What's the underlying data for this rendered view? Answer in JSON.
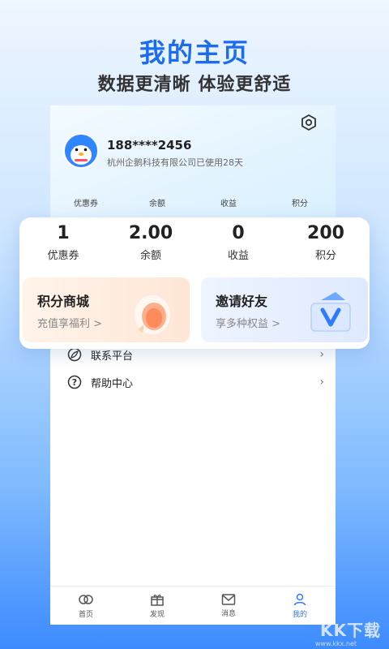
{
  "promo": {
    "title": "我的主页",
    "subtitle": "数据更清晰 体验更舒适"
  },
  "user": {
    "phone": "188****2456",
    "company_line": "杭州企鹅科技有限公司已使用28天"
  },
  "mini_stats": [
    {
      "label": "优惠券"
    },
    {
      "label": "余额"
    },
    {
      "label": "收益"
    },
    {
      "label": "积分"
    }
  ],
  "stats": [
    {
      "value": "1",
      "label": "优惠券"
    },
    {
      "value": "2.00",
      "label": "余额"
    },
    {
      "value": "0",
      "label": "收益"
    },
    {
      "value": "200",
      "label": "积分"
    }
  ],
  "cards": {
    "shop": {
      "title": "积分商城",
      "sub": "充值享福利 >"
    },
    "invite": {
      "title": "邀请好友",
      "sub": "享多种权益 >"
    }
  },
  "menu": [
    {
      "label": "联系平台",
      "icon": "leaf-icon"
    },
    {
      "label": "帮助中心",
      "icon": "question-icon"
    }
  ],
  "tabbar": [
    {
      "label": "首页",
      "icon": "home-icon"
    },
    {
      "label": "发现",
      "icon": "gift-icon"
    },
    {
      "label": "消息",
      "icon": "mail-icon"
    },
    {
      "label": "我的",
      "icon": "user-icon",
      "active": true
    }
  ],
  "watermark": {
    "text": "KK下载",
    "url": "www.kkx.net"
  },
  "colors": {
    "accent": "#2f7bff",
    "title_blue": "#1d6cf0"
  }
}
